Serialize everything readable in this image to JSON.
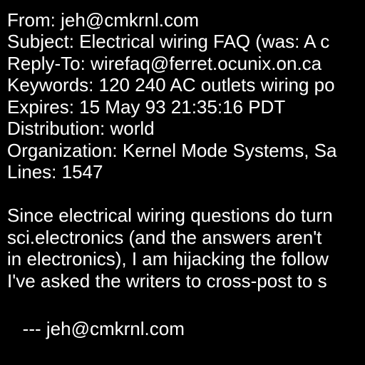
{
  "header": {
    "from": "From: jeh@cmkrnl.com",
    "subject": "Subject: Electrical wiring FAQ (was: A c",
    "reply_to": "Reply-To: wirefaq@ferret.ocunix.on.ca",
    "keywords": "Keywords: 120 240 AC outlets wiring po",
    "expires": "Expires: 15 May 93 21:35:16 PDT",
    "distribution": "Distribution: world",
    "organization": "Organization: Kernel Mode Systems, Sa",
    "lines": "Lines: 1547"
  },
  "body": {
    "lines": [
      "Since electrical wiring questions do turn",
      "sci.electronics (and the answers aren't",
      "in electronics), I am hijacking the follow",
      "I've asked the writers to cross-post to s"
    ]
  },
  "signature": "   --- jeh@cmkrnl.com",
  "colors": {
    "background": "#000000",
    "text": "#ffffff"
  }
}
